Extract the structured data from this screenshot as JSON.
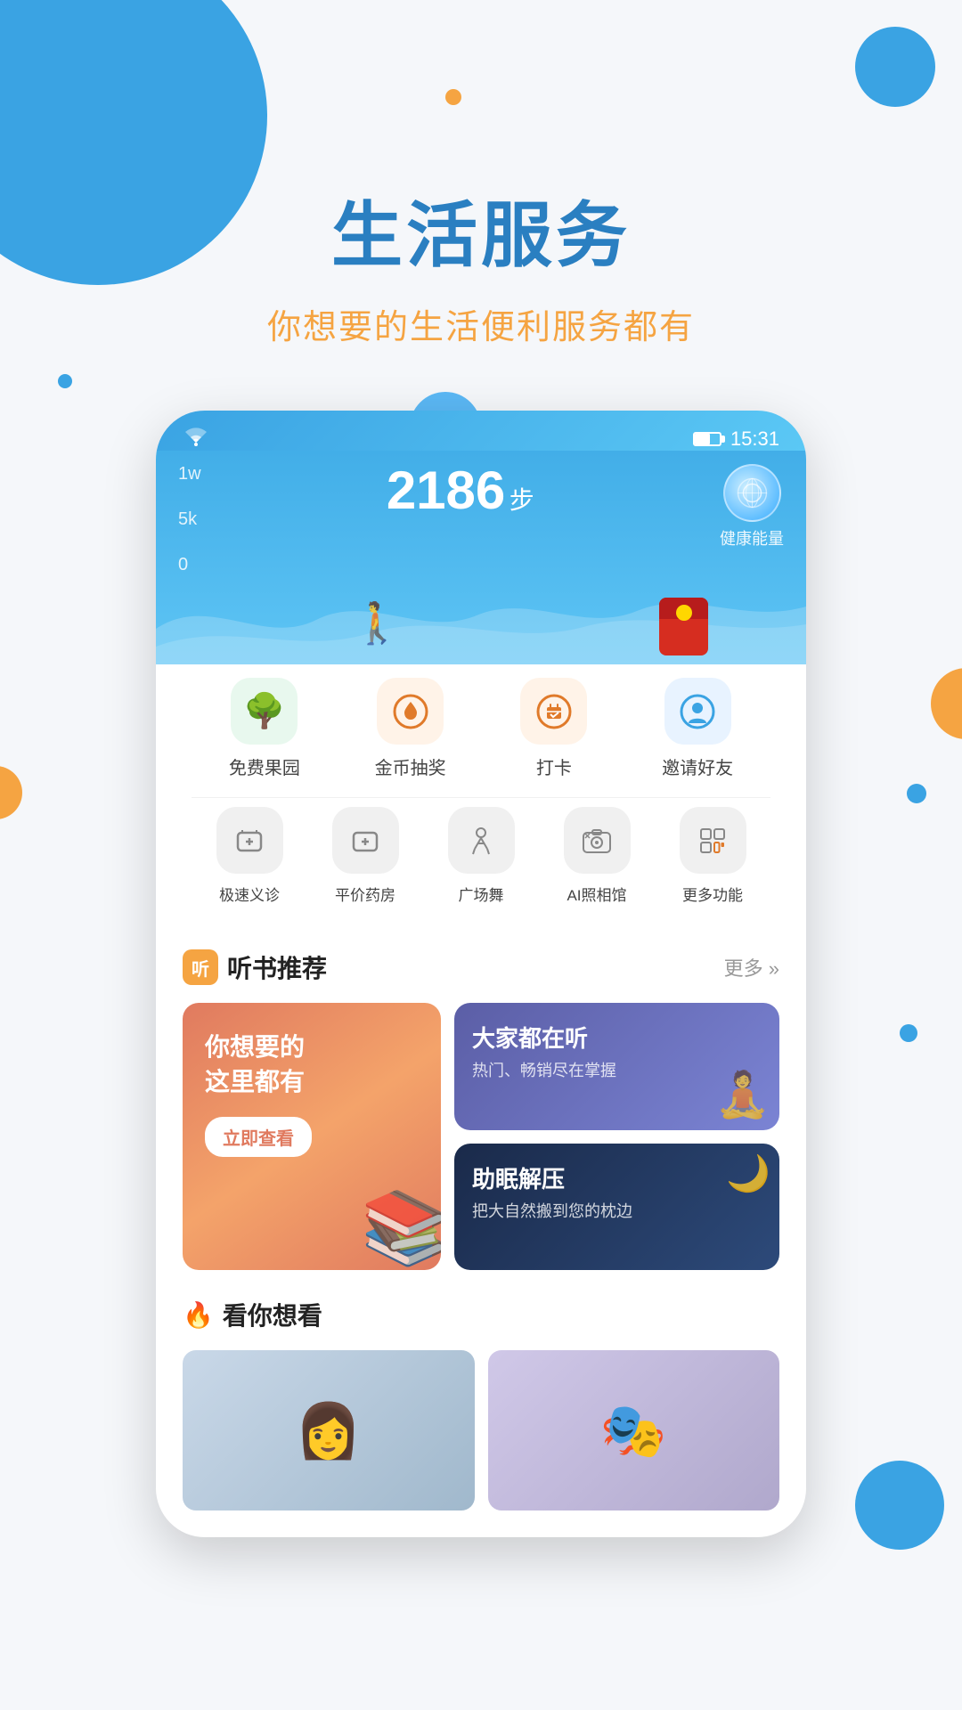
{
  "hero": {
    "title": "生活服务",
    "subtitle": "你想要的生活便利服务都有"
  },
  "phone": {
    "status": {
      "time": "15:31",
      "wifi": "wifi",
      "battery": "battery"
    },
    "steps": {
      "count": "2186",
      "unit": "步",
      "yaxis": [
        "1w",
        "5k",
        "0"
      ],
      "health_label": "健康能量"
    },
    "quick_actions_row1": [
      {
        "label": "免费果园",
        "icon": "🌳",
        "color": "green"
      },
      {
        "label": "金币抽奖",
        "icon": "🔴",
        "color": "orange"
      },
      {
        "label": "打卡",
        "icon": "📅",
        "color": "orange"
      },
      {
        "label": "邀请好友",
        "icon": "👤",
        "color": "blue"
      }
    ],
    "quick_actions_row2": [
      {
        "label": "极速义诊",
        "icon": "➕",
        "color": "gray"
      },
      {
        "label": "平价药房",
        "icon": "💊",
        "color": "gray"
      },
      {
        "label": "广场舞",
        "icon": "💃",
        "color": "gray"
      },
      {
        "label": "AI照相馆",
        "icon": "📷",
        "color": "gray"
      },
      {
        "label": "更多功能",
        "icon": "⊞",
        "color": "gray"
      }
    ],
    "audiobook_section": {
      "icon": "听",
      "title": "听书推荐",
      "more": "更多 »",
      "card_left": {
        "title": "你想要的\n这里都有",
        "btn": "立即查看"
      },
      "card_top_right": {
        "title": "大家都在听",
        "subtitle": "热门、畅销尽在掌握"
      },
      "card_bottom_right": {
        "title": "助眠解压",
        "subtitle": "把大自然搬到您的枕边"
      }
    },
    "watch_section": {
      "title": "看你想看"
    }
  }
}
